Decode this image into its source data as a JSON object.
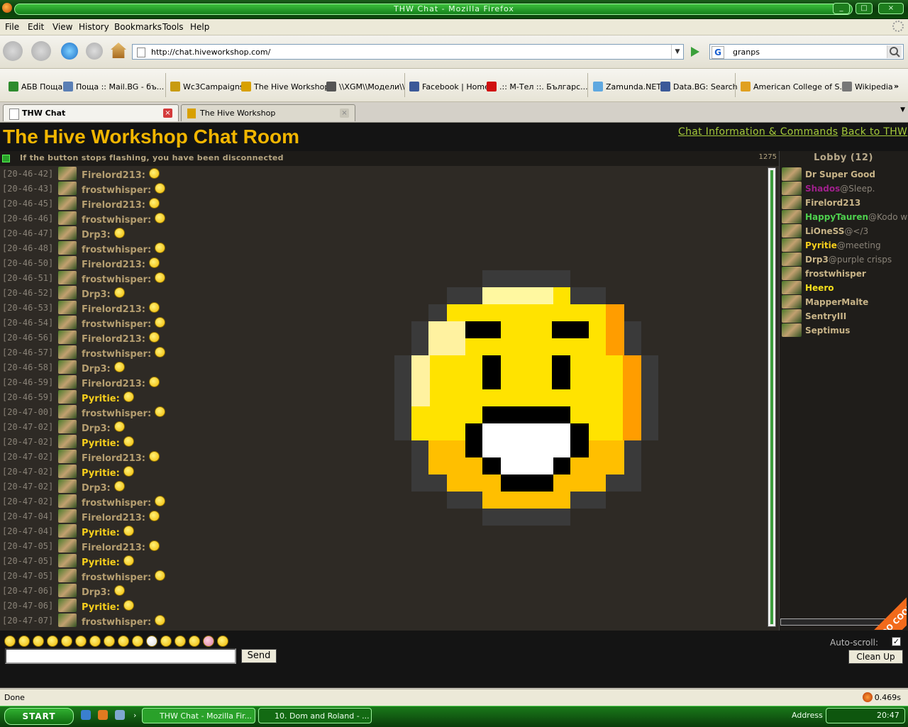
{
  "window": {
    "title": "THW Chat - Mozilla Firefox"
  },
  "menu": [
    "File",
    "Edit",
    "View",
    "History",
    "Bookmarks",
    "Tools",
    "Help"
  ],
  "nav": {
    "url": "http://chat.hiveworkshop.com/",
    "search_value": "granps",
    "search_engine_glyph": "G"
  },
  "bookmarks": [
    {
      "label": "АБВ Поща",
      "color": "#2e8b2e"
    },
    {
      "label": "Поща :: Mail.BG - бъ...",
      "color": "#5a7fb5"
    },
    {
      "label": "Wc3Campaigns",
      "color": "#c89b10"
    },
    {
      "label": "The Hive Workshop",
      "color": "#d8a000"
    },
    {
      "label": "\\\\XGM\\\\Модели\\\\",
      "color": "#555555"
    },
    {
      "label": "Facebook | Home",
      "color": "#3b5998"
    },
    {
      "label": ".:: M-Тел ::. Българс...",
      "color": "#d01010"
    },
    {
      "label": "Zamunda.NET",
      "color": "#5fa8e0"
    },
    {
      "label": "Data.BG: Search",
      "color": "#3b5998"
    },
    {
      "label": "American College of S...",
      "color": "#e0a020"
    },
    {
      "label": "Wikipedia",
      "color": "#777777"
    }
  ],
  "tabs": [
    {
      "label": "THW Chat",
      "active": true
    },
    {
      "label": "The Hive Workshop",
      "active": false
    }
  ],
  "chat": {
    "room_title": "The Hive Workshop Chat Room",
    "links": [
      "Chat Information & Commands",
      "Back to THW"
    ],
    "status_message": "If the button stops flashing, you have been disconnected",
    "counter": "1275",
    "messages": [
      {
        "time": "[20-46-42]",
        "user": "Firelord213:"
      },
      {
        "time": "[20-46-43]",
        "user": "frostwhisper:"
      },
      {
        "time": "[20-46-45]",
        "user": "Firelord213:"
      },
      {
        "time": "[20-46-46]",
        "user": "frostwhisper:"
      },
      {
        "time": "[20-46-47]",
        "user": "Drp3:"
      },
      {
        "time": "[20-46-48]",
        "user": "frostwhisper:"
      },
      {
        "time": "[20-46-50]",
        "user": "Firelord213:"
      },
      {
        "time": "[20-46-51]",
        "user": "frostwhisper:"
      },
      {
        "time": "[20-46-52]",
        "user": "Drp3:"
      },
      {
        "time": "[20-46-53]",
        "user": "Firelord213:"
      },
      {
        "time": "[20-46-54]",
        "user": "frostwhisper:"
      },
      {
        "time": "[20-46-56]",
        "user": "Firelord213:"
      },
      {
        "time": "[20-46-57]",
        "user": "frostwhisper:"
      },
      {
        "time": "[20-46-58]",
        "user": "Drp3:"
      },
      {
        "time": "[20-46-59]",
        "user": "Firelord213:"
      },
      {
        "time": "[20-46-59]",
        "user": "Pyritie:"
      },
      {
        "time": "[20-47-00]",
        "user": "frostwhisper:"
      },
      {
        "time": "[20-47-02]",
        "user": "Drp3:"
      },
      {
        "time": "[20-47-02]",
        "user": "Pyritie:"
      },
      {
        "time": "[20-47-02]",
        "user": "Firelord213:"
      },
      {
        "time": "[20-47-02]",
        "user": "Pyritie:"
      },
      {
        "time": "[20-47-02]",
        "user": "Drp3:"
      },
      {
        "time": "[20-47-02]",
        "user": "frostwhisper:"
      },
      {
        "time": "[20-47-04]",
        "user": "Firelord213:"
      },
      {
        "time": "[20-47-04]",
        "user": "Pyritie:"
      },
      {
        "time": "[20-47-05]",
        "user": "Firelord213:"
      },
      {
        "time": "[20-47-05]",
        "user": "Pyritie:"
      },
      {
        "time": "[20-47-05]",
        "user": "frostwhisper:"
      },
      {
        "time": "[20-47-06]",
        "user": "Drp3:"
      },
      {
        "time": "[20-47-06]",
        "user": "Pyritie:"
      },
      {
        "time": "[20-47-07]",
        "user": "frostwhisper:"
      }
    ],
    "pyritie_color": "#f7cf1c",
    "default_user_color": "#b59e70"
  },
  "lobby": {
    "title": "Lobby (12)",
    "users": [
      {
        "name": "Dr Super Good",
        "status": "",
        "color": "#c8b488"
      },
      {
        "name": "Shados",
        "status": "@Sleep.",
        "color": "#a0208c"
      },
      {
        "name": "Firelord213",
        "status": "",
        "color": "#c8b488"
      },
      {
        "name": "HappyTauren",
        "status": "@Kodo w",
        "color": "#4ed04e"
      },
      {
        "name": "LiOneSS",
        "status": "@</3",
        "color": "#c8b488"
      },
      {
        "name": "Pyritie",
        "status": "@meeting",
        "color": "#f7cf1c"
      },
      {
        "name": "Drp3",
        "status": "@purple crisps",
        "color": "#c8b488"
      },
      {
        "name": "frostwhisper",
        "status": "",
        "color": "#c8b488"
      },
      {
        "name": "Heero",
        "status": "",
        "color": "#f7e01c"
      },
      {
        "name": "MapperMalte",
        "status": "",
        "color": "#c8b488"
      },
      {
        "name": "SentryIII",
        "status": "",
        "color": "#c8b488"
      },
      {
        "name": "Septimus",
        "status": "",
        "color": "#c8b488"
      }
    ]
  },
  "controls": {
    "send_label": "Send",
    "autoscroll_label": "Auto-scroll:",
    "autoscroll_checked": "✓",
    "cleanup_label": "Clean Up",
    "smiley_count": 16,
    "ribbon_text": "TOO COOL FOR IE"
  },
  "statusbar": {
    "text": "Done",
    "timing": "0.469s"
  },
  "taskbar": {
    "start_label": "START",
    "tasks": [
      "THW Chat - Mozilla Fir...",
      "10. Dom and Roland - ..."
    ],
    "address_label": "Address",
    "clock": "20:47"
  },
  "colors": {
    "accent_title": "#f2b600",
    "link_green": "#a4c93a",
    "chat_bg": "#2e2a25"
  }
}
